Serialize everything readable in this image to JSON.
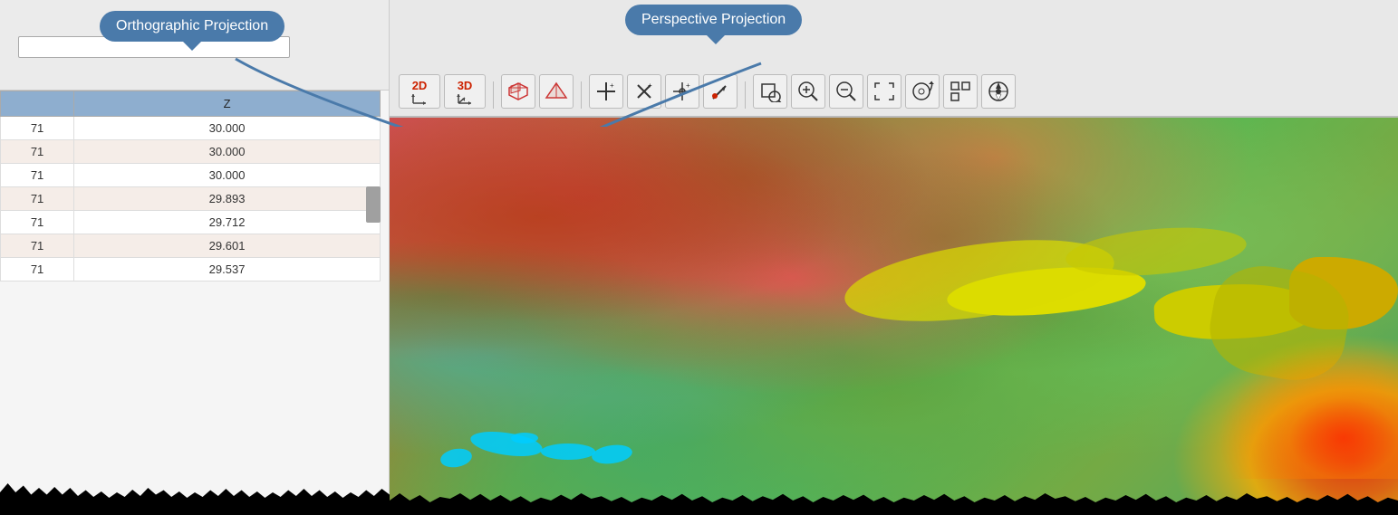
{
  "callouts": {
    "orthographic": "Orthographic Projection",
    "perspective": "Perspective Projection"
  },
  "table": {
    "header": {
      "col1": "",
      "col2": "Z"
    },
    "rows": [
      {
        "id": "71",
        "z": "30.000"
      },
      {
        "id": "71",
        "z": "30.000"
      },
      {
        "id": "71",
        "z": "30.000"
      },
      {
        "id": "71",
        "z": "29.893"
      },
      {
        "id": "71",
        "z": "29.712"
      },
      {
        "id": "71",
        "z": "29.601"
      },
      {
        "id": "71",
        "z": "29.537"
      }
    ]
  },
  "toolbar": {
    "buttons": [
      {
        "id": "2d",
        "label": "2D",
        "sublabel": "↗",
        "active": false
      },
      {
        "id": "3d",
        "label": "3D",
        "sublabel": "↗",
        "active": false
      },
      {
        "id": "box",
        "label": "□",
        "active": false
      },
      {
        "id": "wedge",
        "label": "◇",
        "active": false
      },
      {
        "id": "add-point",
        "label": "+⁺",
        "active": false
      },
      {
        "id": "delete-point",
        "label": "✕⁺",
        "active": false
      },
      {
        "id": "move-point",
        "label": "⊕⁺",
        "active": false
      },
      {
        "id": "draw",
        "label": "↗•",
        "active": false
      },
      {
        "id": "zoom-box",
        "label": "⬚",
        "active": false
      },
      {
        "id": "zoom-in",
        "label": "⊕",
        "active": false
      },
      {
        "id": "zoom-out",
        "label": "⊖",
        "active": false
      },
      {
        "id": "fit",
        "label": "⤢",
        "active": false
      },
      {
        "id": "zoom-prev",
        "label": "⌾",
        "active": false
      },
      {
        "id": "snap",
        "label": "⬚",
        "active": false
      },
      {
        "id": "north",
        "label": "⊕",
        "active": false
      }
    ]
  },
  "colors": {
    "callout_bg": "#4a7aaa",
    "callout_text": "#ffffff",
    "table_header_bg": "#8eaecf",
    "table_row_odd": "#ffffff",
    "table_row_even": "#f5ede8",
    "toolbar_bg": "#e8e8e8"
  }
}
